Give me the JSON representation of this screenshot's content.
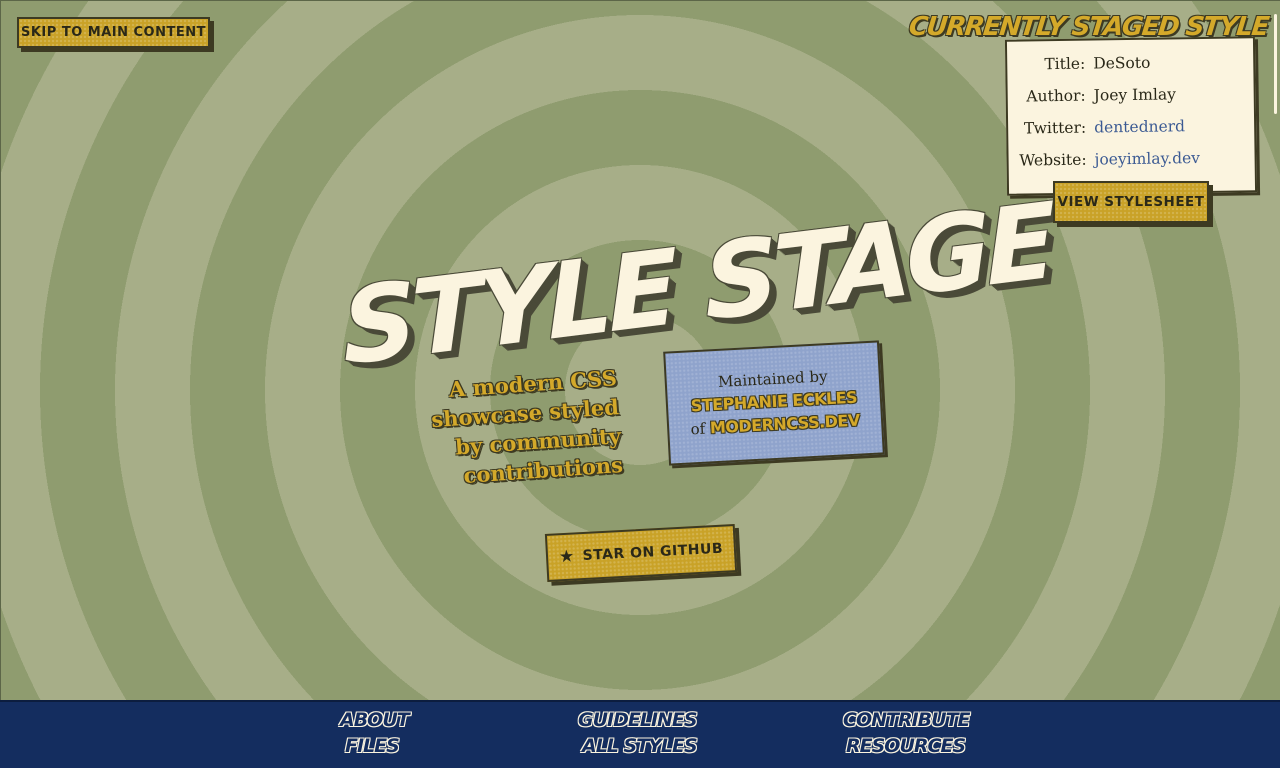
{
  "skip_link": {
    "label": "Skip to main content"
  },
  "staged_style": {
    "heading": "Currently Staged Style",
    "rows": [
      {
        "key": "Title:",
        "value": "DeSoto"
      },
      {
        "key": "Author:",
        "value": "Joey Imlay"
      },
      {
        "key": "Twitter:",
        "value": "dentednerd"
      },
      {
        "key": "Website:",
        "value": "joeyimlay.dev"
      }
    ],
    "view_stylesheet_label": "View Stylesheet"
  },
  "hero": {
    "title": "Style Stage",
    "tagline_lines": [
      "A modern CSS",
      "showcase styled",
      "by community",
      "contributions"
    ]
  },
  "maintainer": {
    "intro": "Maintained by",
    "name": "Stephanie Eckles",
    "of": "of",
    "site": "ModernCSS.dev"
  },
  "github_button": {
    "label": "Star on GitHub",
    "icon": "star-icon"
  },
  "footer_nav": [
    {
      "label": "About"
    },
    {
      "label": "Files"
    },
    {
      "label": "Guidelines"
    },
    {
      "label": "All Styles"
    },
    {
      "label": "Contribute"
    },
    {
      "label": "Resources"
    }
  ],
  "colors": {
    "background_light": "#a7ae88",
    "background_dark": "#8f9c6f",
    "gold": "#c9a227",
    "card": "#fbf4df",
    "maintainer_card": "#8fa3cc",
    "footer": "#142d5f",
    "link": "#3b5a93"
  }
}
